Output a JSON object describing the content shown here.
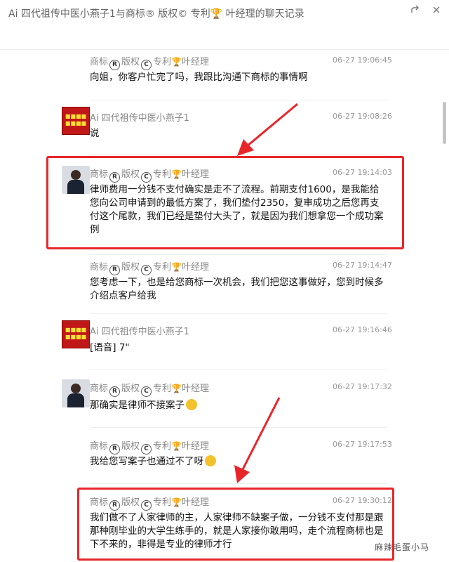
{
  "window": {
    "title": "Ai 四代祖传中医小燕子1与商标® 版权© 专利🏆 叶经理的聊天记录"
  },
  "senders": {
    "manager_prefix": "商标",
    "manager_mid1": "版权",
    "manager_mid2": "专利",
    "manager_suffix": "叶经理",
    "customer": "Ai 四代祖传中医小燕子1"
  },
  "messages": [
    {
      "sender": "manager",
      "time": "06-27 19:06:45",
      "text": "向姐，你客户忙完了吗，我跟比沟通下商标的事情啊"
    },
    {
      "sender": "customer",
      "time": "06-27 19:08:26",
      "text": "说"
    },
    {
      "sender": "manager",
      "time": "06-27 19:14:03",
      "text": "律师费用一分钱不支付确实是走不了流程。前期支付1600，是我能给您向公司申请到的最低方案了，我们垫付2350，复审成功之后您再支付这个尾款，我们已经是垫付大头了，就是因为我们想拿您一个成功案例"
    },
    {
      "sender": "manager",
      "time": "06-27 19:14:47",
      "text": "您考虑一下，也是给您商标一次机会，我们把您这事做好，您到时候多介绍点客户给我"
    },
    {
      "sender": "customer",
      "time": "06-27 19:16:46",
      "text": "[语音] 7\""
    },
    {
      "sender": "manager",
      "time": "06-27 19:17:32",
      "text": "那确实是律师不接案子"
    },
    {
      "sender": "manager",
      "time": "06-27 19:17:53",
      "text": "我给您写案子也通过不了呀"
    },
    {
      "sender": "manager",
      "time": "06-27 19:30:12",
      "text": "我们做不了人家律师的主，人家律师不缺案子做，一分钱不支付那是跟那种刚毕业的大学生练手的，就是人家接你敢用吗，走个流程商标也是下不来的，非得是专业的律师才行"
    }
  ],
  "watermark": "麻辣毛蛋小马",
  "colors": {
    "highlight": "#e8262a",
    "timestamp": "#999999",
    "sender": "#888888"
  },
  "icons": {
    "share": "share-icon",
    "close": "close-icon"
  }
}
